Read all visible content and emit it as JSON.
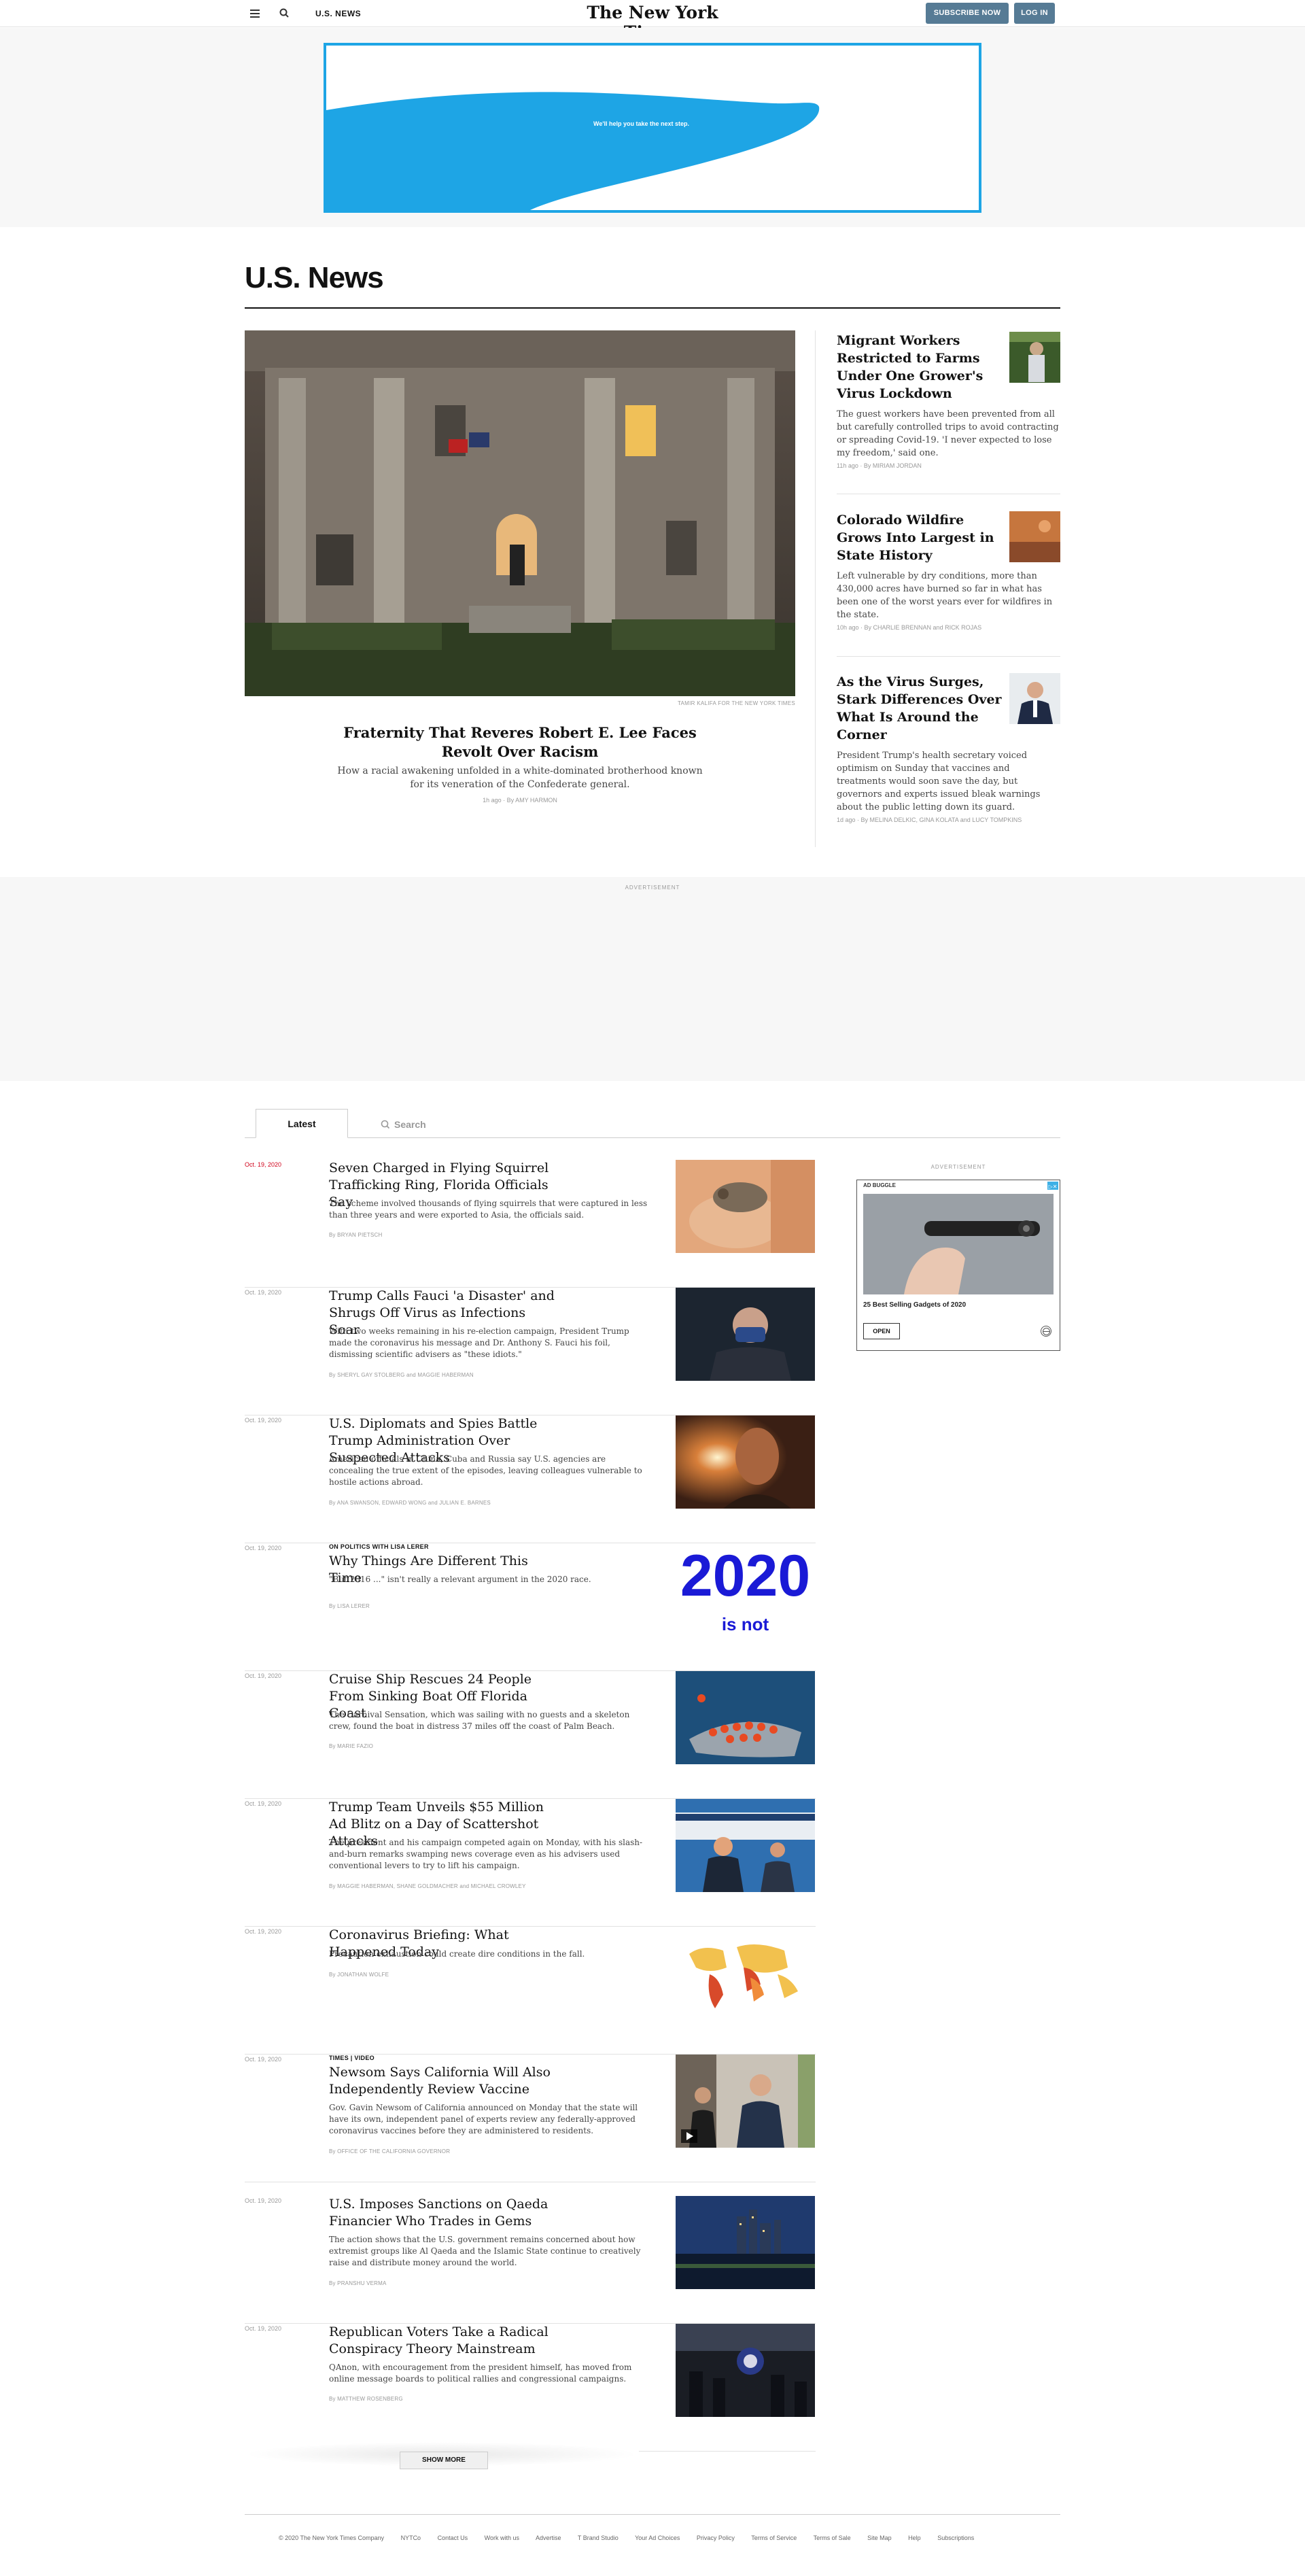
{
  "header": {
    "section_name": "U.S. NEWS",
    "logo": "The New York Times",
    "subscribe_label": "SUBSCRIBE NOW",
    "login_label": "LOG IN"
  },
  "top_ad": {
    "text": "We'll help you take the next step.",
    "colors": {
      "border": "#1ea5e5",
      "wave": "#1ea5e5"
    }
  },
  "section_title": "U.S. News",
  "lead": {
    "photo_credit": "TAMIR KALIFA FOR THE NEW YORK TIMES",
    "headline": "Fraternity That Reveres Robert E. Lee Faces Revolt Over Racism",
    "summary": "How a racial awakening unfolded in a white-dominated brotherhood known for its veneration of the Confederate general.",
    "byline": "1h ago  ·  By AMY HARMON"
  },
  "side_stories": [
    {
      "headline": "Migrant Workers Restricted to Farms Under One Grower's Virus Lockdown",
      "summary": "The guest workers have been prevented from all but carefully controlled trips to avoid contracting or spreading Covid-19. 'I never expected to lose my freedom,' said one.",
      "byline": "11h ago  ·  By MIRIAM JORDAN"
    },
    {
      "headline": "Colorado Wildfire Grows Into Largest in State History",
      "summary": "Left vulnerable by dry conditions, more than 430,000 acres have burned so far in what has been one of the worst years ever for wildfires in the state.",
      "byline": "10h ago  ·  By CHARLIE BRENNAN and RICK ROJAS"
    },
    {
      "headline": "As the Virus Surges, Stark Differences Over What Is Around the Corner",
      "summary": "President Trump's health secretary voiced optimism on Sunday that vaccines and treatments would soon save the day, but governors and experts issued bleak warnings about the public letting down its guard.",
      "byline": "1d ago  ·  By MELINA DELKIC, GINA KOLATA and LUCY TOMPKINS"
    }
  ],
  "mid_ad": {
    "label": "ADVERTISEMENT"
  },
  "tabs": {
    "latest_label": "Latest",
    "search_placeholder": "Search"
  },
  "stream": [
    {
      "date": "Oct. 19, 2020",
      "kicker": "",
      "headline": "Seven Charged in Flying Squirrel Trafficking Ring, Florida Officials Say",
      "summary": "The scheme involved thousands of flying squirrels that were captured in less than three years and were exported to Asia, the officials said.",
      "byline": "By BRYAN PIETSCH"
    },
    {
      "date": "Oct. 19, 2020",
      "kicker": "",
      "headline": "Trump Calls Fauci 'a Disaster' and Shrugs Off Virus as Infections Soar",
      "summary": "With two weeks remaining in his re-election campaign, President Trump made the coronavirus his message and Dr. Anthony S. Fauci his foil, dismissing scientific advisers as \"these idiots.\"",
      "byline": "By SHERYL GAY STOLBERG and MAGGIE HABERMAN"
    },
    {
      "date": "Oct. 19, 2020",
      "kicker": "",
      "headline": "U.S. Diplomats and Spies Battle Trump Administration Over Suspected Attacks",
      "summary": "American officials in China, Cuba and Russia say U.S. agencies are concealing the true extent of the episodes, leaving colleagues vulnerable to hostile actions abroad.",
      "byline": "By ANA SWANSON, EDWARD WONG and JULIAN E. BARNES"
    },
    {
      "date": "Oct. 19, 2020",
      "kicker": "ON POLITICS WITH LISA LERER",
      "headline": "Why Things Are Different This Time",
      "summary": "\"But 2016 ...\" isn't really a relevant argument in the 2020 race.",
      "byline": "By LISA LERER",
      "image_text_big": "2020",
      "image_text_small": "is not"
    },
    {
      "date": "Oct. 19, 2020",
      "kicker": "",
      "headline": "Cruise Ship Rescues 24 People From Sinking Boat Off Florida Coast",
      "summary": "The Carnival Sensation, which was sailing with no guests and a skeleton crew, found the boat in distress 37 miles off the coast of Palm Beach.",
      "byline": "By MARIE FAZIO"
    },
    {
      "date": "Oct. 19, 2020",
      "kicker": "",
      "headline": "Trump Team Unveils $55 Million Ad Blitz on a Day of Scattershot Attacks",
      "summary": "The president and his campaign competed again on Monday, with his slash-and-burn remarks swamping news coverage even as his advisers used conventional levers to try to lift his campaign.",
      "byline": "By MAGGIE HABERMAN, SHANE GOLDMACHER and MICHAEL CROWLEY"
    },
    {
      "date": "Oct. 19, 2020",
      "kicker": "",
      "headline": "Coronavirus Briefing: What Happened Today",
      "summary": "Precaution exhaustion could create dire conditions in the fall.",
      "byline": "By JONATHAN WOLFE"
    },
    {
      "date": "Oct. 19, 2020",
      "kicker": "TIMES  |  VIDEO",
      "headline": "Newsom Says California Will Also Independently Review Vaccine",
      "summary": "Gov. Gavin Newsom of California announced on Monday that the state will have its own, independent panel of experts review any federally-approved coronavirus vaccines before they are administered to residents.",
      "byline": "By OFFICE OF THE CALIFORNIA GOVERNOR"
    },
    {
      "date": "Oct. 19, 2020",
      "kicker": "",
      "headline": "U.S. Imposes Sanctions on Qaeda Financier Who Trades in Gems",
      "summary": "The action shows that the U.S. government remains concerned about how extremist groups like Al Qaeda and the Islamic State continue to creatively raise and distribute money around the world.",
      "byline": "By PRANSHU VERMA"
    },
    {
      "date": "Oct. 19, 2020",
      "kicker": "",
      "headline": "Republican Voters Take a Radical Conspiracy Theory Mainstream",
      "summary": "QAnon, with encouragement from the president himself, has moved from online message boards to political rallies and congressional campaigns.",
      "byline": "By MATTHEW ROSENBERG"
    }
  ],
  "right_ad": {
    "label": "ADVERTISEMENT",
    "brand": "AD BUGGLE",
    "caption": "25 Best Selling Gadgets of 2020",
    "open_label": "OPEN"
  },
  "show_more": "SHOW MORE",
  "footer": [
    "© 2020 The New York Times Company",
    "NYTCo",
    "Contact Us",
    "Work with us",
    "Advertise",
    "T Brand Studio",
    "Your Ad Choices",
    "Privacy Policy",
    "Terms of Service",
    "Terms of Sale",
    "Site Map",
    "Help",
    "Subscriptions"
  ]
}
